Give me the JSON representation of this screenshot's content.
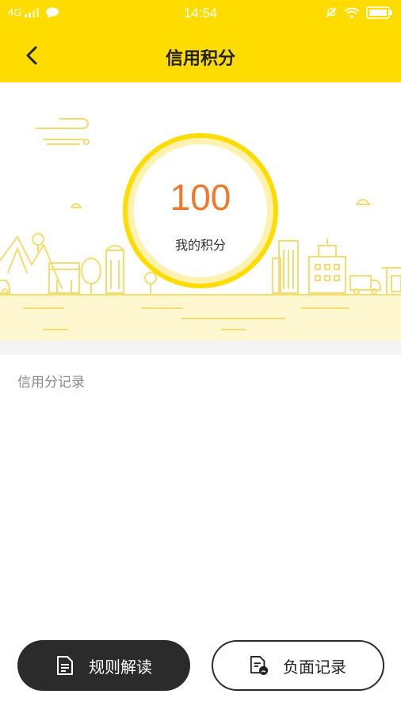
{
  "status_bar": {
    "network": "4G",
    "time": "14:54"
  },
  "header": {
    "title": "信用积分",
    "back_icon": "chevron-left-icon"
  },
  "score": {
    "value": "100",
    "label": "我的积分"
  },
  "records": {
    "title": "信用分记录"
  },
  "actions": {
    "rules_label": "规则解读",
    "rules_icon": "document-icon",
    "negative_label": "负面记录",
    "negative_icon": "negative-record-icon"
  },
  "colors": {
    "brand_yellow": "#FFDC00",
    "score_orange": "#F0782A",
    "dark_button": "#2B2B2B"
  }
}
